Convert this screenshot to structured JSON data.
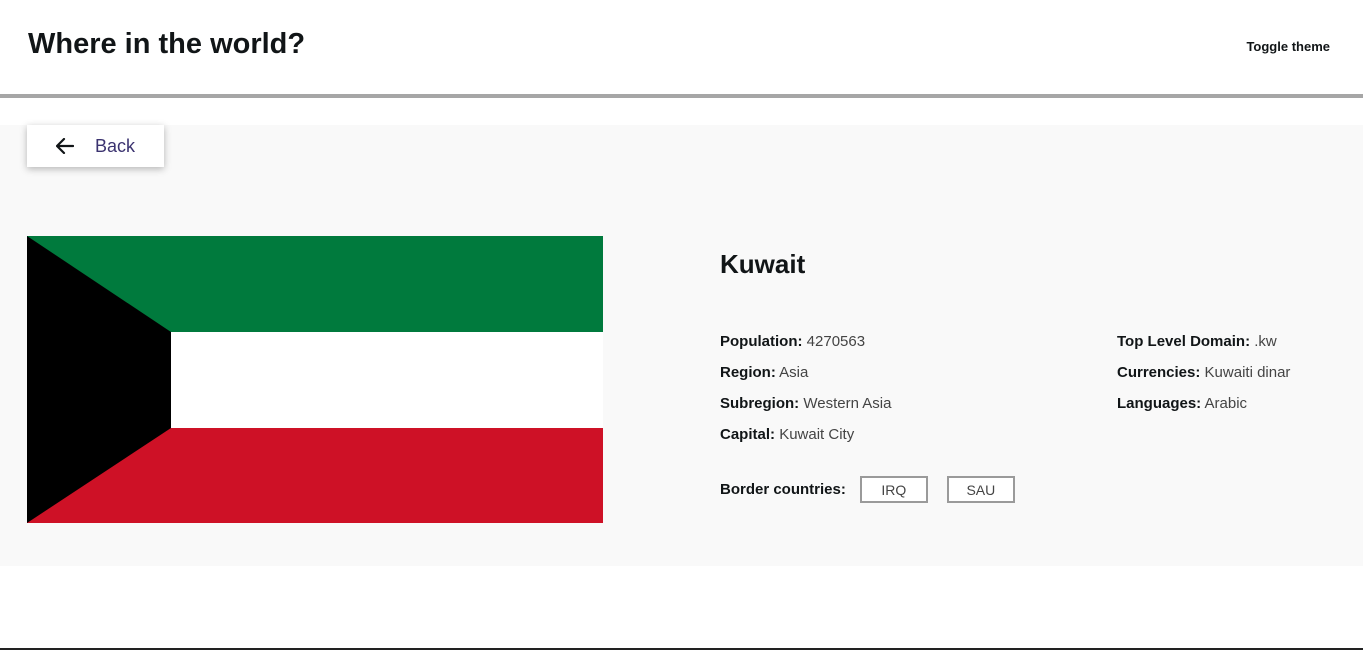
{
  "header": {
    "title": "Where in the world?",
    "toggle_label": "Toggle theme"
  },
  "back_button": {
    "label": "Back",
    "icon": "arrow-left-icon"
  },
  "country": {
    "name": "Kuwait",
    "flag": {
      "icon": "kuwait-flag",
      "colors": {
        "green": "#007a3d",
        "white": "#ffffff",
        "red": "#ce1126",
        "black": "#000000"
      }
    },
    "left_info": [
      {
        "label": "Population:",
        "value": "4270563"
      },
      {
        "label": "Region:",
        "value": "Asia"
      },
      {
        "label": "Subregion:",
        "value": "Western Asia"
      },
      {
        "label": "Capital:",
        "value": "Kuwait City"
      }
    ],
    "right_info": [
      {
        "label": "Top Level Domain:",
        "value": ".kw"
      },
      {
        "label": "Currencies:",
        "value": "Kuwaiti dinar"
      },
      {
        "label": "Languages:",
        "value": "Arabic"
      }
    ],
    "borders_label": "Border countries:",
    "borders": [
      "IRQ",
      "SAU"
    ]
  },
  "colors": {
    "background_main": "#f9f9f9",
    "header_border": "#a6a6a6",
    "back_label": "#3b3370"
  }
}
